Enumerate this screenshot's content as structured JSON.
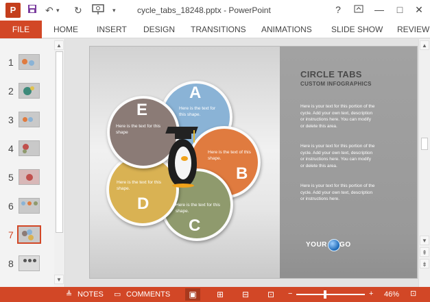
{
  "titlebar": {
    "app_icon": "P",
    "save_icon": "save-icon",
    "undo_icon": "undo-icon",
    "title": "cycle_tabs_18248.pptx - PowerPoint",
    "help": "?",
    "minimize": "—",
    "maximize": "□",
    "close": "✕"
  },
  "ribbon": {
    "file": "FILE",
    "tabs": [
      "HOME",
      "INSERT",
      "DESIGN",
      "TRANSITIONS",
      "ANIMATIONS",
      "SLIDE SHOW",
      "REVIEW"
    ]
  },
  "thumbnails": [
    "1",
    "2",
    "3",
    "4",
    "5",
    "6",
    "7",
    "8"
  ],
  "selected_slide": "7",
  "slide": {
    "title": "CIRCLE TABS",
    "subtitle": "CUSTOM INFOGRAPHICS",
    "paragraphs": [
      "Here is your text for this portion of the cycle. Add your own text, description or instructions here. You can modify or delete this area.",
      "Here is your text for this portion of the cycle. Add your own text, description or instructions here. You can modify or delete this area.",
      "Here is your text for this portion of the cycle. Add your own text, description or instructions here."
    ],
    "logo": "YOUR      LOGO",
    "circles": {
      "A": {
        "letter": "A",
        "text": "Here is the text for this shape.",
        "color": "#8ab3d6"
      },
      "B": {
        "letter": "B",
        "text": "Here is the text of this shape.",
        "color": "#e07b3f"
      },
      "C": {
        "letter": "C",
        "text": "Here is the text for this shape.",
        "color": "#8f9a6d"
      },
      "D": {
        "letter": "D",
        "text": "Here is the text for this shape.",
        "color": "#d9b253"
      },
      "E": {
        "letter": "E",
        "text": "Here is the text for this shape",
        "color": "#8b7b76"
      }
    }
  },
  "statusbar": {
    "notes": "NOTES",
    "comments": "COMMENTS",
    "zoom": "46%"
  },
  "colors": {
    "accent": "#d24726"
  }
}
